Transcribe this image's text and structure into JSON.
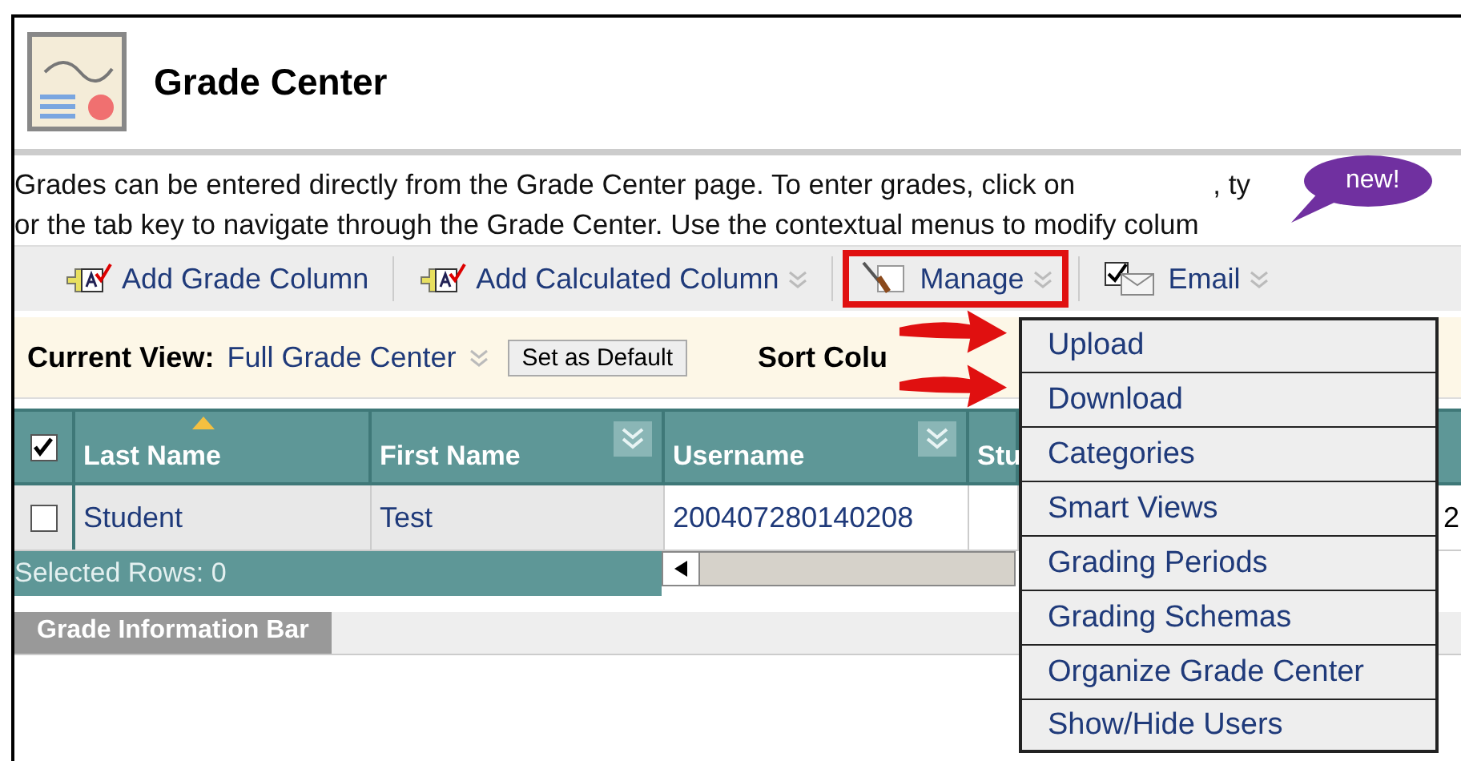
{
  "header": {
    "title": "Grade Center"
  },
  "instructions": {
    "line_1": "Grades can be entered directly from the Grade Center page. To enter grades, click on",
    "line_1_end": ", ty",
    "line_2": "or the tab key to navigate through the Grade Center. Use the contextual menus to modify colum"
  },
  "callout": {
    "text": "new!"
  },
  "toolbar": {
    "items": [
      {
        "label": "Add Grade Column",
        "kind": "add",
        "has_menu": false,
        "highlighted": false
      },
      {
        "label": "Add Calculated Column",
        "kind": "add",
        "has_menu": true,
        "highlighted": false
      },
      {
        "label": "Manage",
        "kind": "manage",
        "has_menu": true,
        "highlighted": true
      },
      {
        "label": "Email",
        "kind": "email",
        "has_menu": true,
        "highlighted": false
      }
    ]
  },
  "view_bar": {
    "label": "Current View:",
    "value": "Full Grade Center",
    "button": "Set as Default",
    "sort_label": "Sort Colu"
  },
  "grid": {
    "select_all_checked": true,
    "columns": [
      {
        "label": "Last Name",
        "sorted": true,
        "has_menu": false
      },
      {
        "label": "First Name",
        "sorted": false,
        "has_menu": true
      },
      {
        "label": "Username",
        "sorted": false,
        "has_menu": true
      },
      {
        "label": "Stu",
        "sorted": false,
        "has_menu": false
      }
    ],
    "rows": [
      {
        "checked": false,
        "cells": [
          "Student",
          "Test",
          "200407280140208",
          "",
          "2"
        ]
      }
    ],
    "footer": "Selected Rows: 0"
  },
  "info_bar": {
    "tab": "Grade Information Bar"
  },
  "manage_menu": {
    "items": [
      {
        "label": "Upload",
        "marked": true
      },
      {
        "label": "Download",
        "marked": true
      },
      {
        "label": "Categories",
        "marked": false
      },
      {
        "label": "Smart Views",
        "marked": false
      },
      {
        "label": "Grading Periods",
        "marked": false
      },
      {
        "label": "Grading Schemas",
        "marked": false
      },
      {
        "label": "Organize Grade Center",
        "marked": false
      },
      {
        "label": "Show/Hide Users",
        "marked": false
      }
    ]
  }
}
